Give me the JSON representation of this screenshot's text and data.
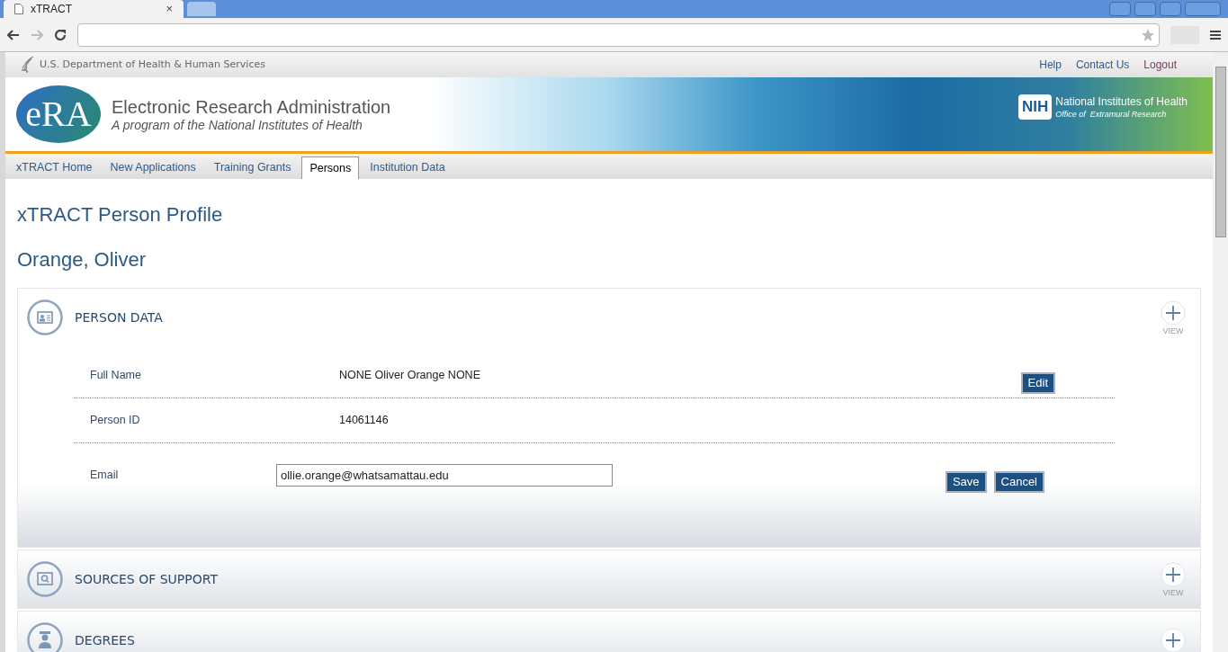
{
  "browser": {
    "tab_title": "xTRACT",
    "tab_close": "×"
  },
  "header": {
    "agency": "U.S. Department of Health & Human Services",
    "links": [
      {
        "label": "Help",
        "kind": "normal"
      },
      {
        "label": "Contact Us",
        "kind": "normal"
      },
      {
        "label": "Logout",
        "kind": "logout"
      }
    ],
    "logo_text": "eRA",
    "title": "Electronic Research Administration",
    "subtitle": "A program of the National Institutes of Health",
    "nih_badge": "NIH",
    "nih_title": "National Institutes of Health",
    "nih_subtitle": "Office of  Extramural Research"
  },
  "nav_tabs": [
    {
      "label": "xTRACT Home",
      "selected": false
    },
    {
      "label": "New Applications",
      "selected": false
    },
    {
      "label": "Training Grants",
      "selected": false
    },
    {
      "label": "Persons",
      "selected": true
    },
    {
      "label": "Institution Data",
      "selected": false
    }
  ],
  "page_title": "xTRACT Person Profile",
  "person_name": "Orange, Oliver",
  "sections": [
    {
      "title": "PERSON DATA",
      "kind": "id-card",
      "view_label": "VIEW",
      "expanded": true,
      "rows": [
        {
          "kind": "text",
          "label": "Full Name",
          "value": "NONE Oliver Orange NONE",
          "buttons": [
            "Edit"
          ]
        },
        {
          "kind": "text",
          "label": "Person ID",
          "value": "14061146",
          "buttons": []
        },
        {
          "kind": "input",
          "label": "Email",
          "value": "ollie.orange@whatsamattau.edu",
          "buttons": [
            "Save",
            "Cancel"
          ]
        }
      ]
    },
    {
      "title": "SOURCES OF SUPPORT",
      "kind": "search",
      "view_label": "VIEW",
      "expanded": false
    },
    {
      "title": "DEGREES",
      "kind": "graduate",
      "expanded": false
    }
  ]
}
